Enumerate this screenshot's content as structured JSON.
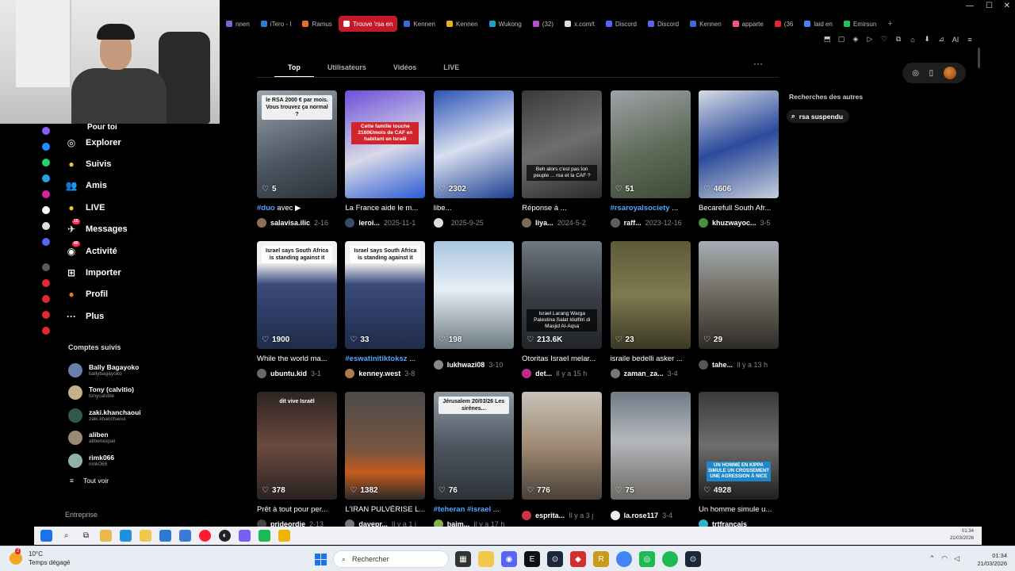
{
  "browser": {
    "tabs": [
      {
        "label": "nnen",
        "color": "#6b6bd6"
      },
      {
        "label": "iTero - I",
        "color": "#2e7bd6"
      },
      {
        "label": "Ramus",
        "color": "#f06b2a"
      },
      {
        "label": "Trouve 'rsa en",
        "color": "#ffffff",
        "active": true
      },
      {
        "label": "Kennen",
        "color": "#3d6bd6"
      },
      {
        "label": "Kennen",
        "color": "#e3b020"
      },
      {
        "label": "Wukong",
        "color": "#1aa0c9"
      },
      {
        "label": "(32)",
        "color": "#b34fd1"
      },
      {
        "label": "x.com/t",
        "color": "#dddddd"
      },
      {
        "label": "Discord",
        "color": "#5865f2"
      },
      {
        "label": "Discord",
        "color": "#5865f2"
      },
      {
        "label": "Kennen",
        "color": "#3d6bd6"
      },
      {
        "label": "apparte",
        "color": "#ff4f73"
      },
      {
        "label": "(36",
        "color": "#e0282e"
      },
      {
        "label": "laid en",
        "color": "#4285f4"
      },
      {
        "label": "Emirsun",
        "color": "#25c15a"
      }
    ],
    "add_tab": "+",
    "win_min": "—",
    "win_max": "☐",
    "win_close": "✕",
    "tools": [
      "⬒",
      "▢",
      "◈",
      "▷",
      "♡",
      "⧉",
      "⌂",
      "⬇",
      "⊿",
      "AI",
      "≡"
    ]
  },
  "sidebar": {
    "partial_item": "Pour toi",
    "items": [
      {
        "name": "explore",
        "label": "Explorer",
        "icon": "◎"
      },
      {
        "name": "following",
        "label": "Suivis",
        "icon": "●"
      },
      {
        "name": "friends",
        "label": "Amis",
        "icon": "👥"
      },
      {
        "name": "live",
        "label": "LIVE",
        "icon": "●"
      },
      {
        "name": "messages",
        "label": "Messages",
        "icon": "✈",
        "badge": "15"
      },
      {
        "name": "activity",
        "label": "Activité",
        "icon": "◉",
        "badge": "40"
      },
      {
        "name": "upload",
        "label": "Importer",
        "icon": "⊞"
      },
      {
        "name": "profile",
        "label": "Profil",
        "icon": "●"
      },
      {
        "name": "more",
        "label": "Plus",
        "icon": "···"
      }
    ],
    "following_title": "Comptes suivis",
    "following": [
      {
        "name": "Bally Bagayoko",
        "handle": "ballybagayoko",
        "color": "#6a7fa8"
      },
      {
        "name": "Tony (calvitio)",
        "handle": "tonycalvitie",
        "color": "#c9b08a"
      },
      {
        "name": "zaki.khanchaoui",
        "handle": "zaki.khanchaoui",
        "color": "#2f5b4a"
      },
      {
        "name": "aliben",
        "handle": "alibenexpat",
        "color": "#9a8a74"
      },
      {
        "name": "rimk066",
        "handle": "rimk066",
        "color": "#8fb4a5"
      }
    ],
    "see_all": "Tout voir",
    "footer": "Entreprise"
  },
  "search_tabs": [
    {
      "label": "Top",
      "active": true
    },
    {
      "label": "Utilisateurs",
      "active": false
    },
    {
      "label": "Vidéos",
      "active": false
    },
    {
      "label": "LIVE",
      "active": false
    }
  ],
  "more_menu": "···",
  "videos": [
    {
      "likes": "5",
      "caption": "avec ▶",
      "tag": "#duo",
      "user": "salavisa.ilic",
      "date": "2-16",
      "bg": "linear-gradient(160deg,#9aa5ad,#4b5560 60%,#2c3238)",
      "overlay_text": "le RSA 2000 € par mois. Vous trouvez ça normal ?",
      "avatar": "#8b6f5a"
    },
    {
      "likes": "",
      "caption": "La France aide le m...",
      "tag": "",
      "user": "leroi...",
      "date": "2025-11-1",
      "bg": "linear-gradient(160deg,#6b4fd9,#d9d9e6 55%,#2a5bd6)",
      "overlay_red": "Cette famille touche 2160€/mois de CAF en habitant en Israël",
      "avatar": "#3b4a66"
    },
    {
      "likes": "2302",
      "caption": "libe...",
      "tag": "",
      "user": "",
      "date": "2025-9-25",
      "bg": "linear-gradient(160deg,#2a55b5,#d9dff0 50%,#1a3f8f)",
      "avatar": "#dddddd"
    },
    {
      "likes": "",
      "caption": "Réponse à ...",
      "tag": "",
      "user": "liya...",
      "date": "2024-5-2",
      "bg": "linear-gradient(160deg,#3a3a3a,#6e6e6e 50%,#2b2b2b)",
      "overlay_dark": "Beh alors c'est pas ton peuple ... rsa et la CAF ?",
      "avatar": "#7a6b5e"
    },
    {
      "likes": "51",
      "caption": "...",
      "tag": "#rsaroyalsociety",
      "user": "raff...",
      "date": "2023-12-16",
      "bg": "linear-gradient(160deg,#9ea3a8,#5f6a58 55%,#3e4a38)",
      "avatar": "#5d5d5d"
    },
    {
      "likes": "4606",
      "caption": "Becarefull South Afr...",
      "tag": "",
      "user": "khuzwayoc...",
      "date": "3-5",
      "bg": "linear-gradient(160deg,#d6dbe6,#2b4a9b 50%,#c8cfdb)",
      "avatar": "#4a8f3a"
    },
    {
      "likes": "1900",
      "caption": "While the world ma...",
      "tag": "",
      "user": "ubuntu.kid",
      "date": "3-1",
      "bg": "linear-gradient(180deg,#f2f2f2 0%,#f2f2f2 20%,#3a4b7a 40%,#1f2b4a 100%)",
      "overlay_text": "Israel says South Africa is standing against it",
      "avatar": "#6a6a6a"
    },
    {
      "likes": "33",
      "caption": "...",
      "tag": "#eswatinitiktoksz",
      "user": "kenney.west",
      "date": "3-8",
      "bg": "linear-gradient(180deg,#f2f2f2 0%,#f2f2f2 20%,#3a4b7a 40%,#1f2b4a 100%)",
      "overlay_text": "Israel says South Africa is standing against it",
      "avatar": "#b07a4a"
    },
    {
      "likes": "198",
      "caption": "",
      "tag": "",
      "user": "lukhwazi08",
      "date": "3-10",
      "bg": "linear-gradient(180deg,#a9c6df,#e6eef5 45%,#6d7a82)",
      "avatar": "#888888"
    },
    {
      "likes": "213.6K",
      "caption": "Otoritas Israel melar...",
      "tag": "",
      "user": "det...",
      "date": "Il y a 15 h",
      "bg": "linear-gradient(180deg,#6f7780,#3a3f45 50%,#22262a)",
      "overlay_dark": "Israel Larang Warga Palestina Salat Idulfitri di Masjid Al-Aqsa",
      "avatar": "#c22a8a"
    },
    {
      "likes": "23",
      "caption": "israile bedelli asker ...",
      "tag": "",
      "user": "zaman_za...",
      "date": "3-4",
      "bg": "linear-gradient(180deg,#5d5a3a,#7f7a4f 50%,#3a3826)",
      "avatar": "#777777"
    },
    {
      "likes": "29",
      "caption": "",
      "tag": "",
      "user": "tahe...",
      "date": "Il y a 13 h",
      "bg": "linear-gradient(180deg,#a6adb5,#6f6a60 50%,#2e2b27)",
      "avatar": "#555555"
    },
    {
      "likes": "378",
      "caption": "Prêt à tout pour per...",
      "tag": "",
      "user": "prideordie",
      "date": "2-13",
      "bg": "linear-gradient(180deg,#2d2522,#6b4a3f 50%,#2a2320)",
      "overlay_top": "dit vive Israël",
      "avatar": "#444444"
    },
    {
      "likes": "1382",
      "caption": "L'IRAN PULVÉRISE L...",
      "tag": "",
      "user": "davepr...",
      "date": "Il y a 1 j",
      "bg": "linear-gradient(180deg,#4a4a4a,#7a5540 55%,#c45a1e 75%,#2a2a2a)",
      "avatar": "#777777"
    },
    {
      "likes": "76",
      "caption": "...",
      "tag": "#teheran #israel",
      "user": "baim...",
      "date": "Il y a 17 h",
      "bg": "linear-gradient(180deg,#8e98a3,#4d5560 50%,#2e3338)",
      "overlay_text": "Jérusalem 20/03/26 Les sirènes...",
      "avatar": "#7fb04a"
    },
    {
      "likes": "776",
      "caption": "",
      "tag": "",
      "user": "esprita...",
      "date": "Il y a 3 j",
      "bg": "linear-gradient(180deg,#c7c2b8,#a08a74 50%,#4a4038)",
      "avatar": "#cc3344"
    },
    {
      "likes": "75",
      "caption": "",
      "tag": "",
      "user": "la.rose117",
      "date": "3-4",
      "bg": "linear-gradient(180deg,#6f7a86,#b5b8bc 45%,#6e6a66)",
      "avatar": "#eeeeee"
    },
    {
      "likes": "4928",
      "caption": "Un homme simule u...",
      "tag": "",
      "user": "trtfrancais",
      "date": "",
      "bg": "linear-gradient(180deg,#3a3a3a,#6e6e6e 50%,#1f1f1f)",
      "overlay_blue": "UN HOMME EN KIPPA SIMULE UN CROSSEMENT UNE AGRESSION À NICE",
      "avatar": "#29b6c8"
    }
  ],
  "right_panel": {
    "title": "Recherches des autres",
    "suggestion": "rsa suspendu"
  },
  "inner_taskbar": {
    "clock_time": "01:34",
    "clock_date": "21/03/2026"
  },
  "os": {
    "temp": "10°C",
    "weather": "Temps dégagé",
    "weather_badge": "2",
    "search_placeholder": "Rechercher",
    "clock_time": "01:34",
    "clock_date": "21/03/2026"
  }
}
